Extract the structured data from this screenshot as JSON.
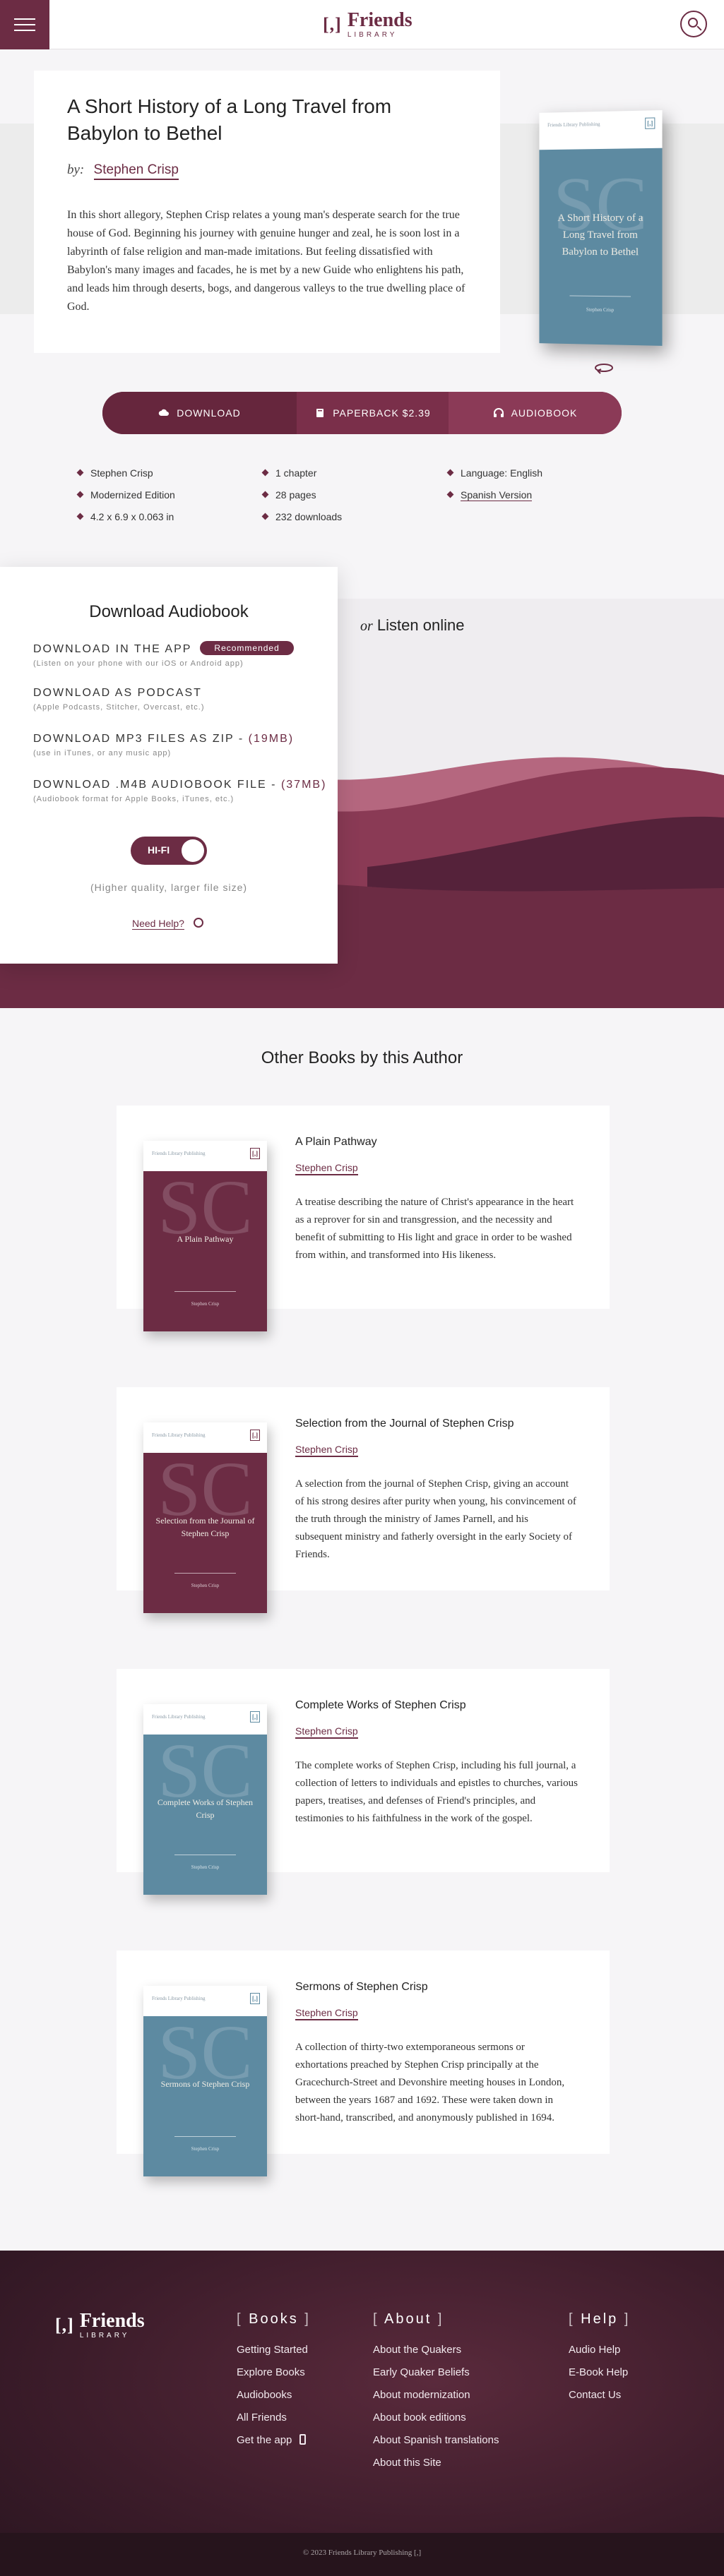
{
  "header": {
    "logo_mark": "[,]",
    "logo_name": "Friends",
    "logo_sub": "LIBRARY"
  },
  "book": {
    "title": "A Short History of a Long Travel from Babylon to Bethel",
    "by": "by:",
    "author": "Stephen Crisp",
    "description": "In this short allegory, Stephen Crisp relates a young man's desperate search for the true house of God. Beginning his journey with genuine hunger and zeal, he is soon lost in a labyrinth of false religion and man-made imitations. But feeling dissatisfied with Babylon's many images and facades, he is met by a new Guide who enlightens his path, and leads him through deserts, bogs, and dangerous valleys to the true dwelling place of God.",
    "cover": {
      "top_label": "Friends Library Publishing",
      "monogram": "SC",
      "title": "A Short History of a Long Travel from Babylon to Bethel",
      "author": "Stephen Crisp",
      "color": "#5d8aa1"
    }
  },
  "download_bar": {
    "download": "DOWNLOAD",
    "paperback": "PAPERBACK $2.39",
    "audiobook": "AUDIOBOOK"
  },
  "meta": {
    "col1": [
      "Stephen Crisp",
      "Modernized Edition",
      "4.2 x 6.9 x 0.063 in"
    ],
    "col2": [
      "1 chapter",
      "28 pages",
      "232 downloads"
    ],
    "col3_language": "Language: English",
    "col3_link": "Spanish Version"
  },
  "audio": {
    "title": "Download Audiobook",
    "options": [
      {
        "label": "DOWNLOAD IN THE APP",
        "badge": "Recommended",
        "size": "",
        "sub": "(Listen on your phone with our iOS or Android app)"
      },
      {
        "label": "DOWNLOAD AS PODCAST",
        "badge": "",
        "size": "",
        "sub": "(Apple Podcasts, Stitcher, Overcast, etc.)"
      },
      {
        "label": "DOWNLOAD MP3 FILES AS ZIP - ",
        "badge": "",
        "size": "(19MB)",
        "sub": "(use in iTunes, or any music app)"
      },
      {
        "label": "DOWNLOAD .M4B AUDIOBOOK FILE - ",
        "badge": "",
        "size": "(37MB)",
        "sub": "(Audiobook format for Apple Books, iTunes, etc.)"
      }
    ],
    "toggle_label": "HI-FI",
    "toggle_on": true,
    "toggle_note": "(Higher quality, larger file size)",
    "help": "Need Help?",
    "listen_or": "or",
    "listen_online": "Listen online"
  },
  "other_books": {
    "title": "Other Books by this Author",
    "items": [
      {
        "title": "A Plain Pathway",
        "author": "Stephen Crisp",
        "cover_title": "A Plain Pathway",
        "cover_color": "#6c2c44",
        "cover_label": "Friends Library Publishing",
        "monogram": "SC",
        "description": "A treatise describing the nature of Christ's appearance in the heart as a reprover for sin and transgression, and the necessity and benefit of submitting to His light and grace in order to be washed from within, and transformed into His likeness."
      },
      {
        "title": "Selection from the Journal of Stephen Crisp",
        "author": "Stephen Crisp",
        "cover_title": "Selection from the Journal of Stephen Crisp",
        "cover_color": "#6c2c44",
        "cover_label": "Friends Library Publishing",
        "monogram": "SC",
        "description": "A selection from the journal of Stephen Crisp, giving an account of his strong desires after purity when young, his convincement of the truth through the ministry of James Parnell, and his subsequent ministry and fatherly oversight in the early Society of Friends."
      },
      {
        "title": "Complete Works of Stephen Crisp",
        "author": "Stephen Crisp",
        "cover_title": "Complete Works of Stephen Crisp",
        "cover_color": "#5d8aa1",
        "cover_label": "Friends Library Publishing",
        "monogram": "SC",
        "description": "The complete works of Stephen Crisp, including his full journal, a collection of letters to individuals and epistles to churches, various papers, treatises, and defenses of Friend's principles, and testimonies to his faithfulness in the work of the gospel."
      },
      {
        "title": "Sermons of Stephen Crisp",
        "author": "Stephen Crisp",
        "cover_title": "Sermons of Stephen Crisp",
        "cover_color": "#5d8aa1",
        "cover_label": "Friends Library Publishing",
        "monogram": "SC",
        "description": "A collection of thirty-two extemporaneous sermons or exhortations preached by Stephen Crisp principally at the Gracechurch-Street and Devonshire meeting houses in London, between the years 1687 and 1692. These were taken down in short-hand, transcribed, and anonymously published in 1694."
      }
    ]
  },
  "footer": {
    "books_title": "Books",
    "books_links": [
      "Getting Started",
      "Explore Books",
      "Audiobooks",
      "All Friends",
      "Get the app"
    ],
    "about_title": "About",
    "about_links": [
      "About the Quakers",
      "Early Quaker Beliefs",
      "About modernization",
      "About book editions",
      "About Spanish translations",
      "About this Site"
    ],
    "help_title": "Help",
    "help_links": [
      "Audio Help",
      "E-Book Help",
      "Contact Us"
    ],
    "copyright": "© 2023 Friends Library Publishing [,]"
  },
  "colors": {
    "maroon": "#6c2c44",
    "blue": "#5d8aa1"
  },
  "icons": [
    "menu-icon",
    "search-icon",
    "cloud-icon",
    "book-icon",
    "headphones-icon",
    "flip-icon",
    "help-icon",
    "phone-icon",
    "diamond-bullet-icon"
  ]
}
